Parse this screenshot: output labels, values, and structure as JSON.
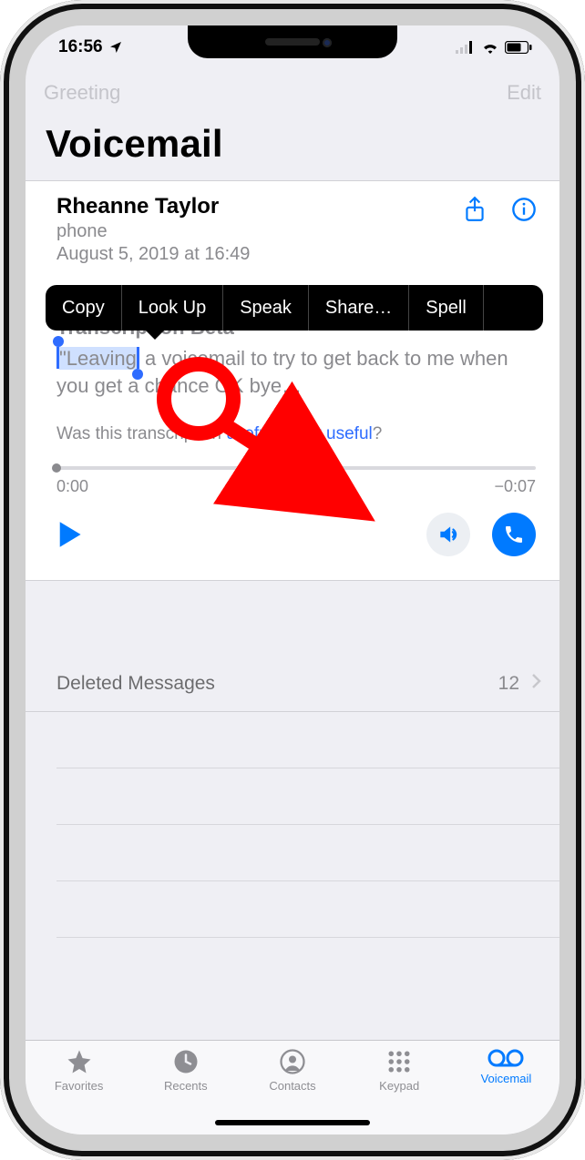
{
  "status": {
    "time": "16:56"
  },
  "nav": {
    "left": "Greeting",
    "right": "Edit"
  },
  "title": "Voicemail",
  "voicemail": {
    "caller": "Rheanne Taylor",
    "label": "phone",
    "date": "August 5, 2019 at 16:49",
    "transcription_heading": "Transcription Beta",
    "transcription_selected": "\"Leaving",
    "transcription_rest": " a voicemail to try to get back to me when you get a chance OK bye…",
    "feedback_prefix": "Was this transcription ",
    "feedback_useful": "useful",
    "feedback_or": " or ",
    "feedback_not_useful": "not useful",
    "feedback_suffix": "?",
    "elapsed": "0:00",
    "remaining": "−0:07"
  },
  "context_menu": [
    "Copy",
    "Look Up",
    "Speak",
    "Share…",
    "Spell"
  ],
  "deleted": {
    "label": "Deleted Messages",
    "count": "12"
  },
  "tabs": [
    {
      "label": "Favorites"
    },
    {
      "label": "Recents"
    },
    {
      "label": "Contacts"
    },
    {
      "label": "Keypad"
    },
    {
      "label": "Voicemail"
    }
  ]
}
